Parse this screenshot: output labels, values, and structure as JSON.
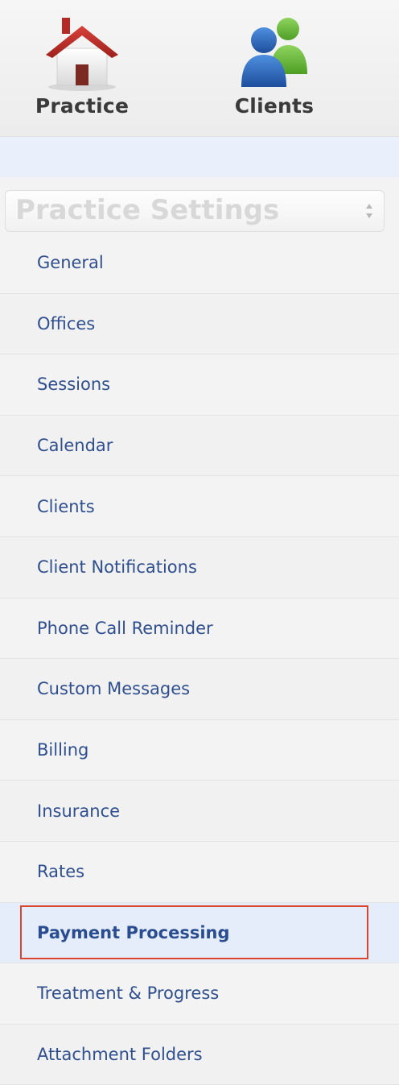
{
  "top_nav": {
    "practice": {
      "label": "Practice",
      "icon": "house-icon"
    },
    "clients": {
      "label": "Clients",
      "icon": "users-icon"
    }
  },
  "settings_select": {
    "value": "Practice Settings",
    "icon": "select-arrows-icon"
  },
  "menu": {
    "items": [
      {
        "label": "General"
      },
      {
        "label": "Offices"
      },
      {
        "label": "Sessions"
      },
      {
        "label": "Calendar"
      },
      {
        "label": "Clients"
      },
      {
        "label": "Client Notifications"
      },
      {
        "label": "Phone Call Reminder"
      },
      {
        "label": "Custom Messages"
      },
      {
        "label": "Billing"
      },
      {
        "label": "Insurance"
      },
      {
        "label": "Rates"
      },
      {
        "label": "Payment Processing",
        "active": true
      },
      {
        "label": "Treatment & Progress"
      },
      {
        "label": "Attachment Folders"
      }
    ]
  },
  "colors": {
    "menu_text": "#2f4f8f",
    "active_bg": "#e6edfa",
    "highlight_border": "#d9452f",
    "house_roof": "#c0302a",
    "user_blue": "#2f6fc0",
    "user_green": "#6cbf3b"
  }
}
